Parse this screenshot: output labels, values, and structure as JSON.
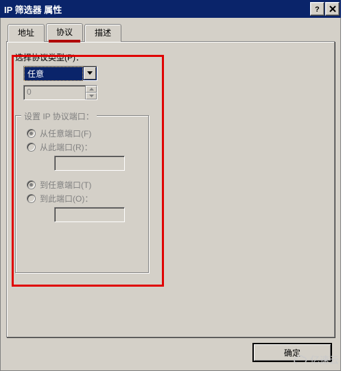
{
  "dialog": {
    "title": "IP 筛选器 属性"
  },
  "tabs": {
    "address": "地址",
    "protocol": "协议",
    "description": "描述"
  },
  "protocol_section": {
    "label": "选择协议类型(P)：",
    "dropdown_value": "任意",
    "spinner_value": "0"
  },
  "port_group": {
    "legend": "设置 IP 协议端口：",
    "from_any": "从任意端口(F)",
    "from_this": "从此端口(R)：",
    "to_any": "到任意端口(T)",
    "to_this": "到此端口(O)："
  },
  "buttons": {
    "ok": "确定"
  },
  "watermark": "亿速云"
}
